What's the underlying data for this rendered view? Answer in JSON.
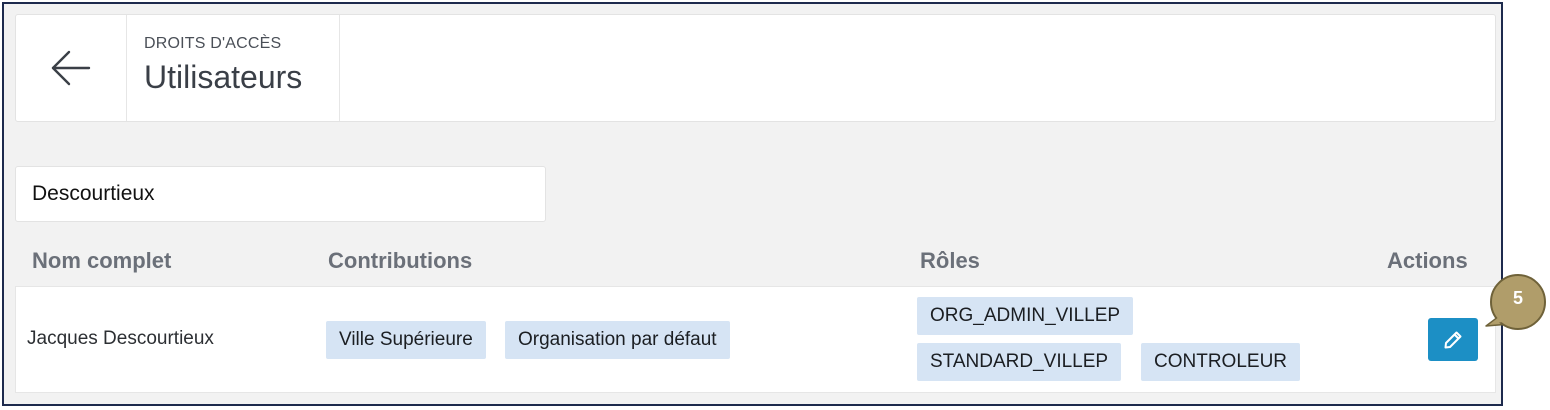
{
  "header": {
    "breadcrumb": "DROITS D'ACCÈS",
    "title": "Utilisateurs"
  },
  "search": {
    "value": "Descourtieux"
  },
  "table": {
    "columns": [
      "Nom complet",
      "Contributions",
      "Rôles",
      "Actions"
    ],
    "rows": [
      {
        "name": "Jacques Descourtieux",
        "contributions": [
          "Ville Supérieure",
          "Organisation par défaut"
        ],
        "roles": [
          "ORG_ADMIN_VILLEP",
          "STANDARD_VILLEP",
          "CONTROLEUR"
        ]
      }
    ]
  },
  "icons": {
    "back": "arrow-left-icon",
    "edit": "pencil-icon"
  },
  "callout": {
    "number": "5",
    "color": "#b09d6a"
  },
  "colors": {
    "accent": "#1c8fc5",
    "tag_background": "#d6e4f4",
    "frame_border": "#1d2a4d"
  }
}
